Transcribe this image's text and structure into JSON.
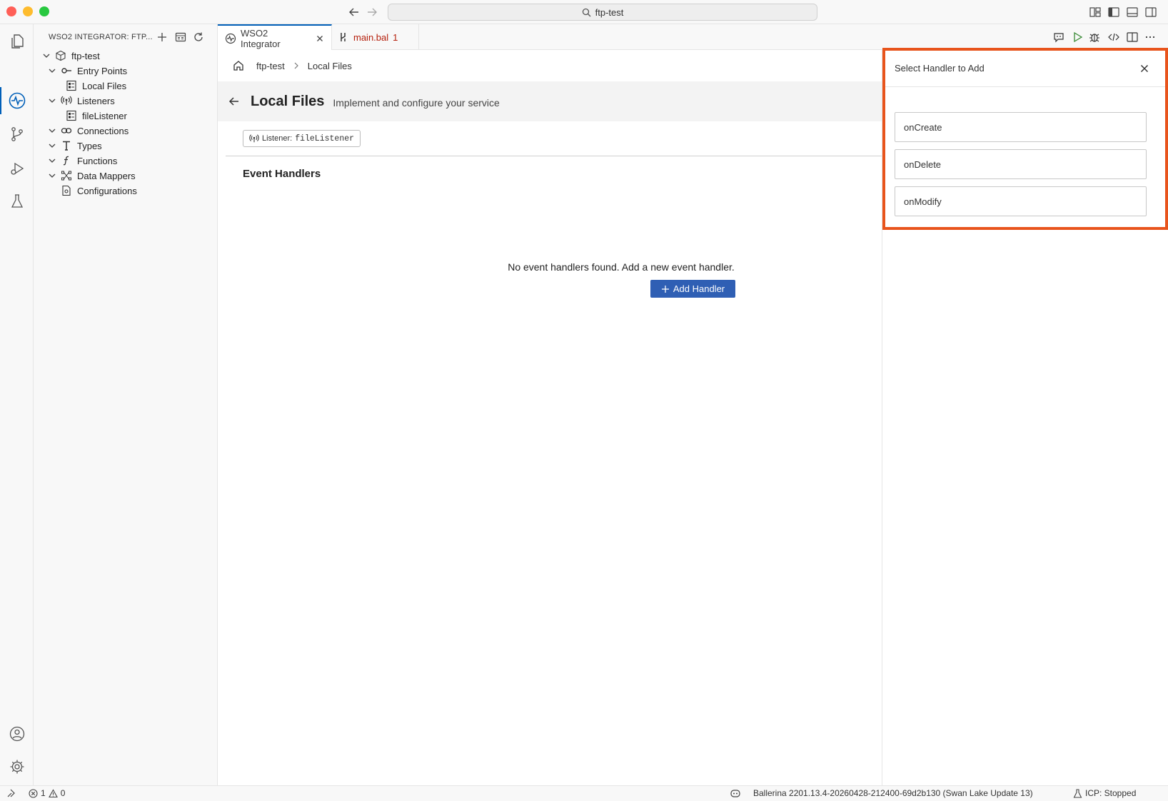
{
  "window": {
    "search_text": "ftp-test"
  },
  "sidebar": {
    "title": "WSO2 INTEGRATOR: FTP...",
    "tree": {
      "root": "ftp-test",
      "entry_points": "Entry Points",
      "local_files": "Local Files",
      "listeners": "Listeners",
      "file_listener": "fileListener",
      "connections": "Connections",
      "types": "Types",
      "functions": "Functions",
      "data_mappers": "Data Mappers",
      "configurations": "Configurations"
    }
  },
  "tabs": [
    {
      "label": "WSO2 Integrator"
    },
    {
      "label": "main.bal",
      "problems": "1"
    }
  ],
  "editor": {
    "breadcrumb": [
      "ftp-test",
      "Local Files"
    ],
    "title": "Local Files",
    "subtitle": "Implement and configure your service",
    "listener_label": "Listener:",
    "listener_name": "fileListener",
    "section_title": "Event Handlers",
    "empty_message": "No event handlers found. Add a new event handler.",
    "add_button": "Add Handler"
  },
  "panel": {
    "title": "Select Handler to Add",
    "handlers": [
      "onCreate",
      "onDelete",
      "onModify"
    ],
    "highlight_color": "#e8541c"
  },
  "statusbar": {
    "errors": "1",
    "warnings": "0",
    "ballerina": "Ballerina 2201.13.4-20260428-212400-69d2b130 (Swan Lake Update 13)",
    "icp": "ICP: Stopped"
  },
  "colors": {
    "accent": "#005fb8",
    "button": "#2f5fb4",
    "tab_problem": "#b5200d",
    "run_green": "#388a34"
  }
}
